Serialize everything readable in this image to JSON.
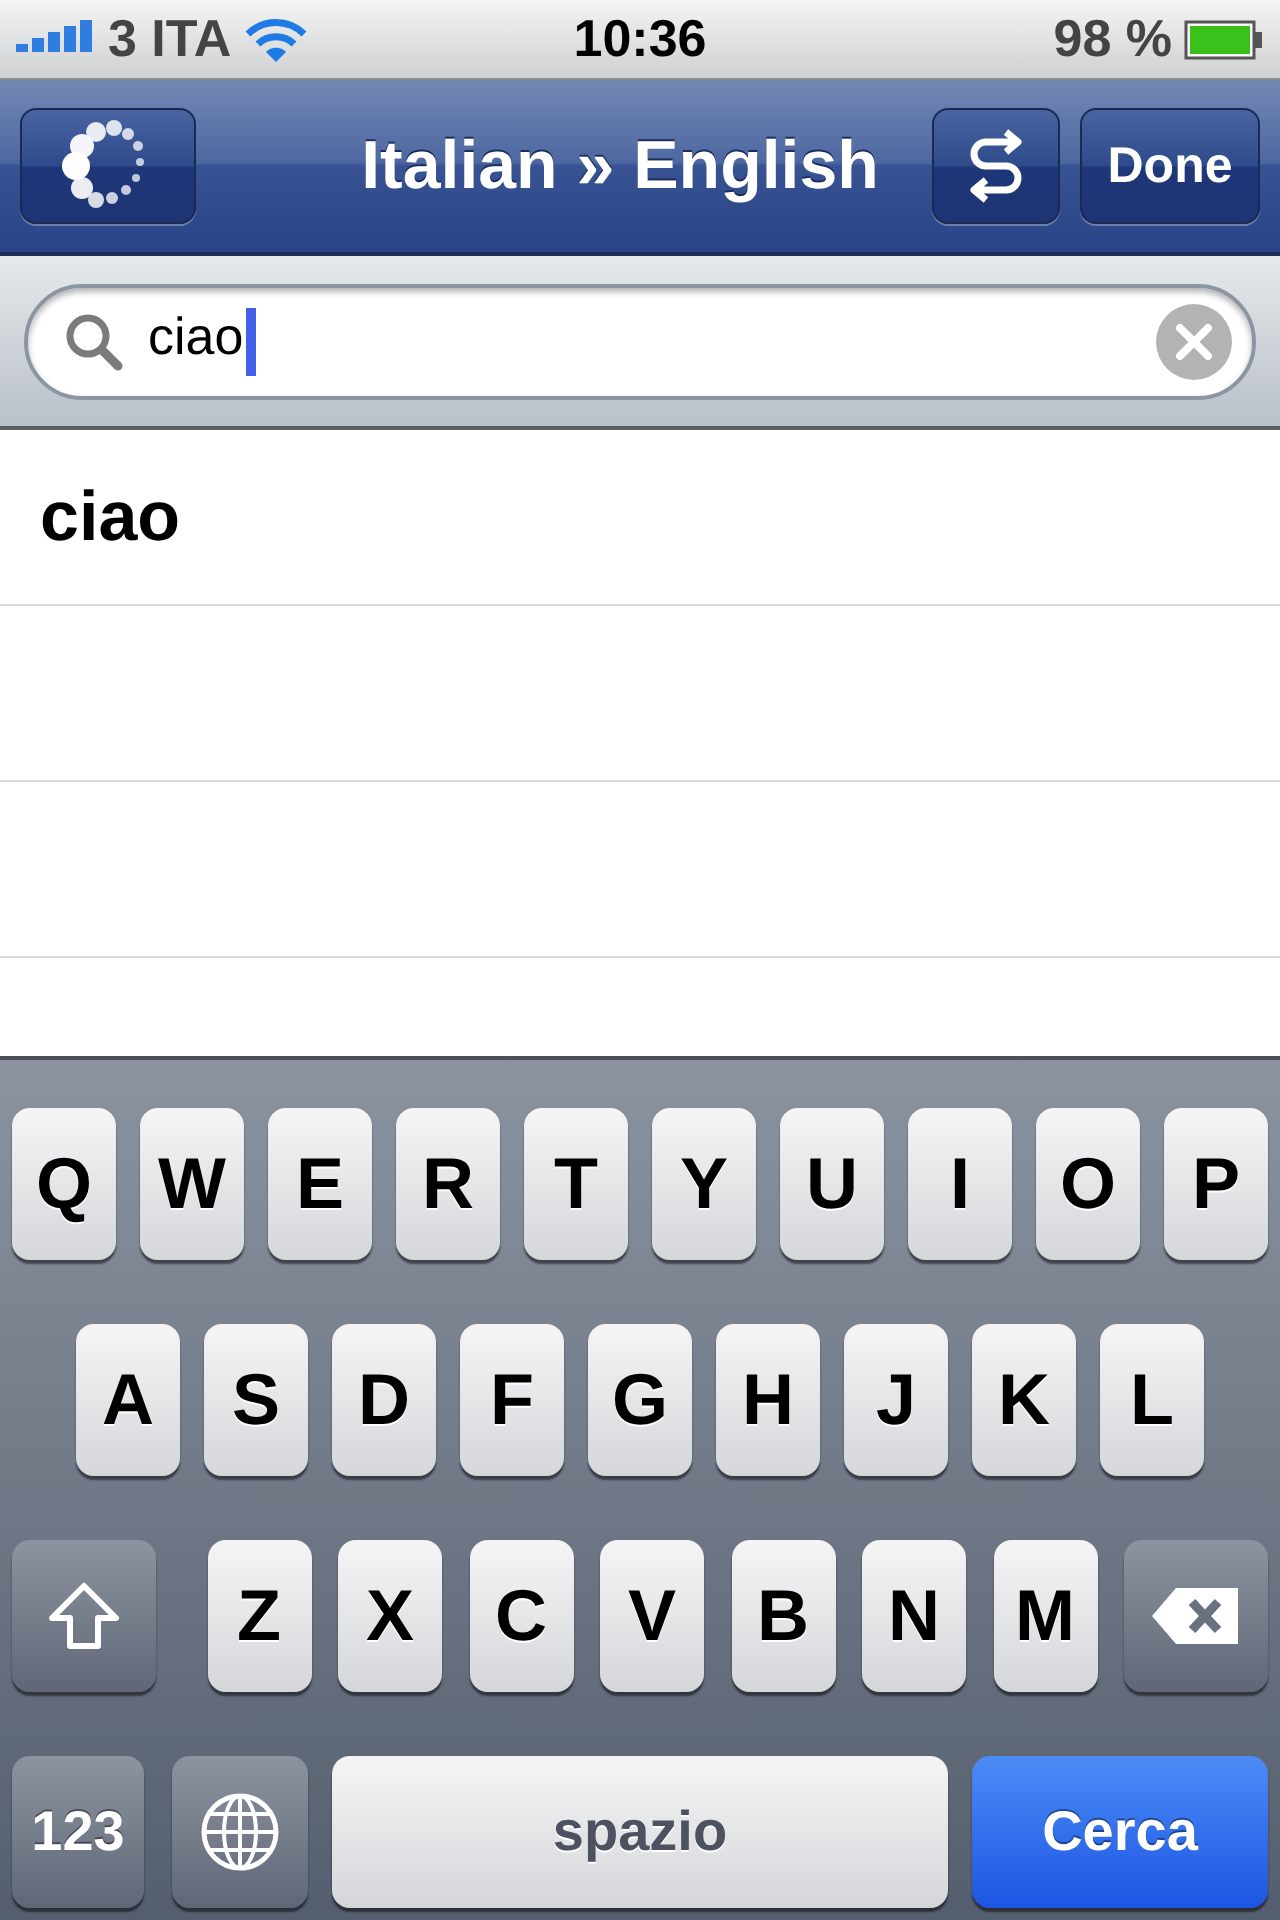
{
  "status_bar": {
    "carrier": "3 ITA",
    "time": "10:36",
    "battery": "98 %"
  },
  "nav_bar": {
    "title": "Italian » English",
    "done_button": "Done"
  },
  "search": {
    "value": "ciao"
  },
  "results": [
    {
      "label": "ciao"
    }
  ],
  "keyboard": {
    "top_letters": [
      "Q",
      "W",
      "E",
      "R",
      "T",
      "Y",
      "U",
      "I",
      "O",
      "P"
    ],
    "middle_letters": [
      "A",
      "S",
      "D",
      "F",
      "G",
      "H",
      "J",
      "K",
      "L"
    ],
    "bottom_letters": [
      "Z",
      "X",
      "C",
      "V",
      "B",
      "N",
      "M"
    ],
    "numbers_key": "123",
    "space_key": "spazio",
    "action_key": "Cerca"
  }
}
